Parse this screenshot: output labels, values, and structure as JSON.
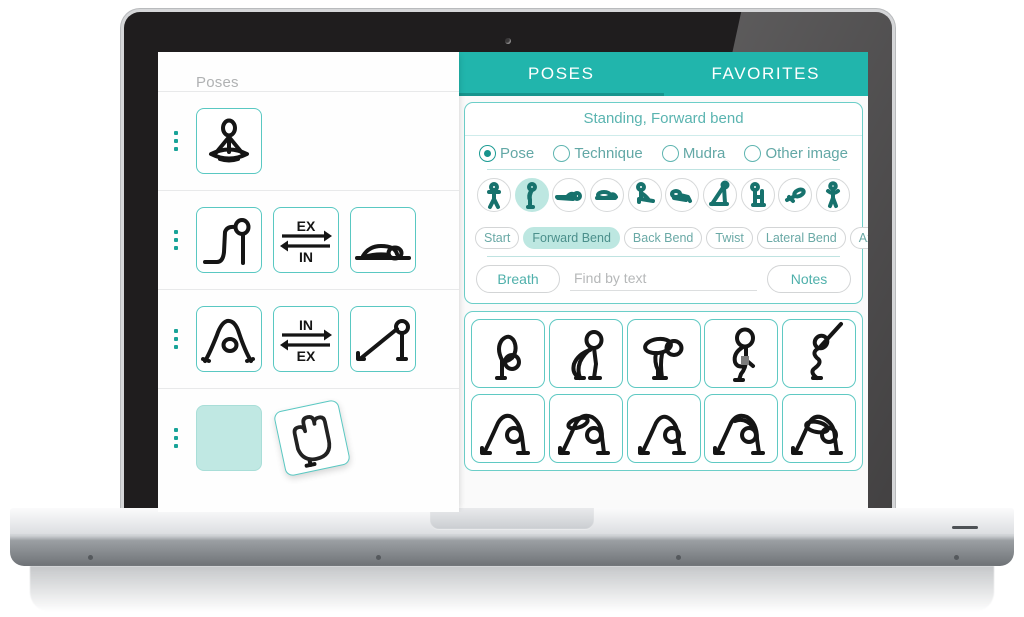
{
  "device": {
    "kind": "laptop-mockup"
  },
  "left_pane": {
    "title": "Poses",
    "rows": [
      {
        "name": "sequence-row-1",
        "tiles": [
          {
            "type": "pose",
            "icon": "lotus-seated-pose-icon"
          }
        ]
      },
      {
        "name": "sequence-row-2",
        "tiles": [
          {
            "type": "pose",
            "icon": "cobra-pose-icon"
          },
          {
            "type": "breath",
            "icon": "breath-arrows-icon",
            "top_label": "EX",
            "bottom_label": "IN"
          },
          {
            "type": "pose",
            "icon": "prone-rest-pose-icon"
          }
        ]
      },
      {
        "name": "sequence-row-3",
        "tiles": [
          {
            "type": "pose",
            "icon": "downward-dog-pose-icon"
          },
          {
            "type": "breath",
            "icon": "breath-arrows-icon",
            "top_label": "IN",
            "bottom_label": "EX"
          },
          {
            "type": "pose",
            "icon": "inclined-plank-pose-icon"
          }
        ]
      },
      {
        "name": "sequence-row-4",
        "tiles": [
          {
            "type": "drop-target",
            "icon": "empty-drop-slot"
          },
          {
            "type": "pose-dragging",
            "icon": "standing-forward-bend-pose-icon",
            "cursor": "grab-hand-icon"
          }
        ]
      }
    ]
  },
  "right_pane": {
    "tabs": [
      {
        "id": "poses",
        "label": "POSES",
        "active": true
      },
      {
        "id": "favorites",
        "label": "FAVORITES",
        "active": false
      }
    ],
    "filter_card": {
      "title": "Standing, Forward bend",
      "image_type": {
        "options": [
          {
            "label": "Pose",
            "selected": true
          },
          {
            "label": "Technique",
            "selected": false
          },
          {
            "label": "Mudra",
            "selected": false
          },
          {
            "label": "Other image",
            "selected": false
          }
        ]
      },
      "position_icons": [
        {
          "name": "standing-position-icon",
          "selected": false
        },
        {
          "name": "standing-forward-bend-icon",
          "selected": true
        },
        {
          "name": "supine-lying-icon",
          "selected": false
        },
        {
          "name": "prone-lying-icon",
          "selected": false
        },
        {
          "name": "seated-icon",
          "selected": false
        },
        {
          "name": "kneeling-icon",
          "selected": false
        },
        {
          "name": "inverted-icon",
          "selected": false
        },
        {
          "name": "chair-supported-icon",
          "selected": false
        },
        {
          "name": "arm-support-icon",
          "selected": false
        },
        {
          "name": "standing-twist-icon",
          "selected": false
        }
      ],
      "movement_chips": [
        {
          "label": "Start",
          "selected": false
        },
        {
          "label": "Forward Bend",
          "selected": true
        },
        {
          "label": "Back Bend",
          "selected": false
        },
        {
          "label": "Twist",
          "selected": false
        },
        {
          "label": "Lateral Bend",
          "selected": false
        },
        {
          "label": "Axial Extension",
          "selected": false
        }
      ],
      "breath_button": "Breath",
      "notes_button": "Notes",
      "search_placeholder": "Find by text",
      "search_value": ""
    },
    "results": {
      "rows": [
        [
          {
            "icon": "standing-forward-bend-result-1"
          },
          {
            "icon": "standing-forward-bend-result-2"
          },
          {
            "icon": "standing-forward-bend-result-3"
          },
          {
            "icon": "standing-forward-bend-result-4"
          },
          {
            "icon": "standing-forward-bend-result-5"
          }
        ],
        [
          {
            "icon": "downward-dog-result-1"
          },
          {
            "icon": "downward-dog-result-2"
          },
          {
            "icon": "downward-dog-result-3"
          },
          {
            "icon": "downward-dog-result-4"
          },
          {
            "icon": "downward-dog-result-5"
          }
        ]
      ]
    }
  },
  "colors": {
    "teal_header": "#21b5ac",
    "teal_underline": "#17948d",
    "teal_border": "#6ccec8",
    "teal_fill": "#bde7e1",
    "text_teal": "#5ab4b0",
    "muted": "#b0b2b3"
  }
}
